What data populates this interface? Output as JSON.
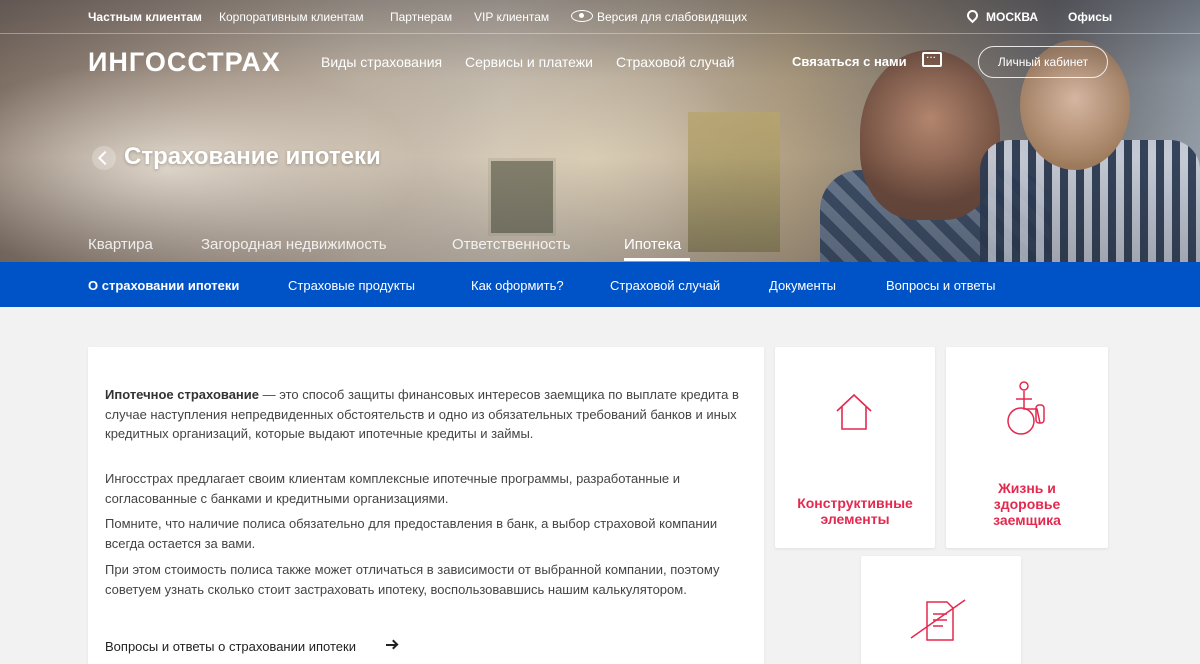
{
  "topbar": {
    "items": [
      "Частным клиентам",
      "Корпоративным клиентам",
      "Партнерам",
      "VIP клиентам"
    ],
    "accessibility": "Версия для слабовидящих",
    "city": "МОСКВА",
    "offices": "Офисы"
  },
  "header": {
    "logo": "ИНГОССТРАХ",
    "nav": [
      "Виды страхования",
      "Сервисы и платежи",
      "Страховой случай"
    ],
    "contact": "Связаться с нами",
    "cabinet": "Личный кабинет"
  },
  "hero": {
    "title": "Страхование ипотеки",
    "tabs": [
      "Квартира",
      "Загородная недвижимость",
      "Ответственность",
      "Ипотека"
    ],
    "active_tab": "Ипотека"
  },
  "subnav": {
    "items": [
      "О страховании ипотеки",
      "Страховые продукты",
      "Как оформить?",
      "Страховой случай",
      "Документы",
      "Вопросы и ответы"
    ],
    "active": "О страховании ипотеки"
  },
  "content": {
    "p1_bold": "Ипотечное страхование",
    "p1_rest": " — это способ защиты финансовых интересов заемщика по выплате кредита в случае наступления непредвиденных обстоятельств и одно из обязательных требований банков и иных кредитных организаций, которые выдают ипотечные кредиты и займы.",
    "p2": "Ингосстрах предлагает своим клиентам комплексные ипотечные программы, разработанные и согласованные с банками и кредитными организациями.",
    "p3": "Помните, что наличие полиса обязательно для предоставления в банк, а выбор страховой компании всегда остается за вами.",
    "p4": "При этом стоимость полиса также может отличаться в зависимости от выбранной компании, поэтому советуем узнать сколько стоит застраховать ипотеку, воспользовавшись нашим калькулятором.",
    "faq_link": "Вопросы и ответы о страховании ипотеки"
  },
  "tiles": {
    "t1": {
      "line1": "Конструктивные",
      "line2": "элементы",
      "icon": "house-icon"
    },
    "t2": {
      "line1": "Жизнь и",
      "line2": "здоровье",
      "line3": "заемщика",
      "icon": "wheelchair-icon"
    },
    "t3": {
      "icon": "document-crossed-icon"
    }
  },
  "colors": {
    "accent_blue": "#0052c7",
    "accent_red": "#e3294f"
  }
}
